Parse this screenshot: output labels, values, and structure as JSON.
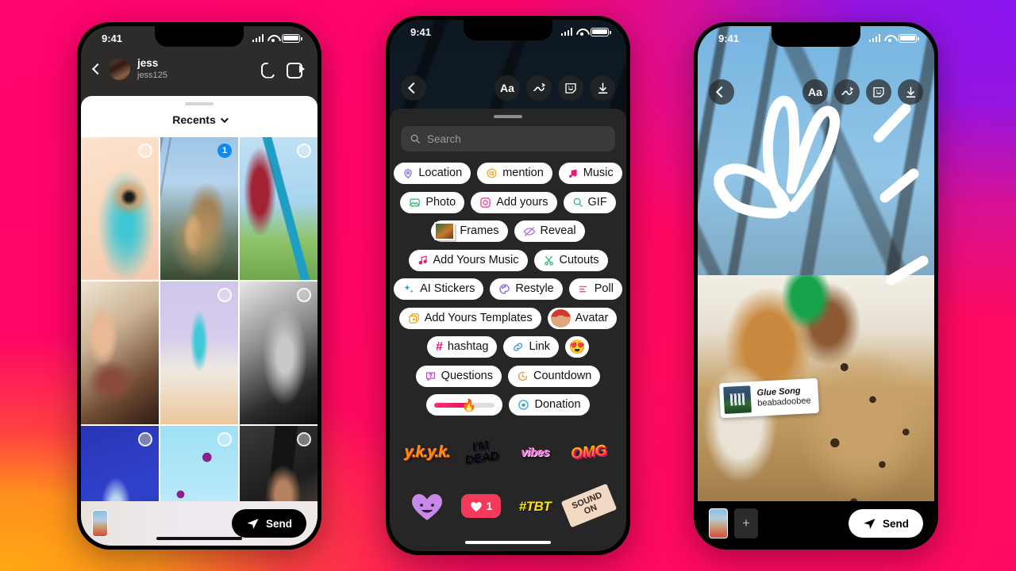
{
  "background": {
    "gradient_colors": [
      "#FF0470",
      "#8A16F0",
      "#FFA812",
      "#FF0A60"
    ]
  },
  "phones": {
    "phone1": {
      "name": "dm-gallery-picker",
      "status_bar": {
        "time": "9:41",
        "icons": [
          "signal-icon",
          "wifi-icon",
          "battery-icon"
        ]
      },
      "dm_header": {
        "back_icon": "back-chevron-icon",
        "display_name": "jess",
        "username": "jess125",
        "call_icon": "phone-call-icon",
        "video_icon": "video-call-icon"
      },
      "sheet": {
        "album_label": "Recents",
        "album_chevron": "chevron-down-icon",
        "grid": [
          {
            "id": "tile-1",
            "style": "ph-a",
            "selection": "empty"
          },
          {
            "id": "tile-2",
            "style": "ph-b",
            "selection": "1"
          },
          {
            "id": "tile-3",
            "style": "ph-c",
            "selection": "empty"
          },
          {
            "id": "tile-4",
            "style": "ph-d",
            "selection": "none"
          },
          {
            "id": "tile-5",
            "style": "ph-e",
            "selection": "empty"
          },
          {
            "id": "tile-6",
            "style": "ph-f",
            "selection": "empty"
          },
          {
            "id": "tile-7",
            "style": "ph-g",
            "selection": "grey"
          },
          {
            "id": "tile-8",
            "style": "ph-h",
            "selection": "empty"
          },
          {
            "id": "tile-9",
            "style": "ph-i",
            "selection": "grey"
          }
        ]
      },
      "bottom_bar": {
        "send_label": "Send",
        "send_icon": "paper-plane-icon",
        "thumb": "selected-photo-thumbnail"
      }
    },
    "phone2": {
      "name": "sticker-tray",
      "status_bar": {
        "time": "9:41",
        "icons": [
          "signal-icon",
          "wifi-icon",
          "battery-icon"
        ]
      },
      "top_bar": {
        "back_icon": "back-chevron-icon",
        "tools": [
          "text-tool-icon",
          "draw-tool-icon",
          "sticker-tool-icon",
          "download-icon"
        ],
        "text_tool_label": "Aa"
      },
      "search": {
        "placeholder": "Search",
        "icon": "search-icon"
      },
      "chip_rows": [
        [
          {
            "label": "Location",
            "icon": "location-pin-icon",
            "color": "#7b5cf0"
          },
          {
            "label": "mention",
            "icon": "threads-at-icon",
            "color": "#f5a524"
          },
          {
            "label": "Music",
            "icon": "music-note-icon",
            "color": "#e8197d"
          }
        ],
        [
          {
            "label": "Photo",
            "icon": "photo-icon",
            "color": "#2bb673"
          },
          {
            "label": "Add yours",
            "icon": "camera-icon",
            "color": "#ef2e8a"
          },
          {
            "label": "GIF",
            "icon": "gif-search-icon",
            "color": "#2bb673"
          }
        ],
        [
          {
            "label": "Frames",
            "icon": "polaroid-frames-icon",
            "color": "#c86a3a"
          },
          {
            "label": "Reveal",
            "icon": "reveal-eye-icon",
            "color": "#b06ae8"
          }
        ],
        [
          {
            "label": "Add Yours Music",
            "icon": "music-note-icon",
            "color": "#e8197d"
          },
          {
            "label": "Cutouts",
            "icon": "scissors-icon",
            "color": "#2bb673"
          }
        ],
        [
          {
            "label": "AI Stickers",
            "icon": "ai-sparkle-icon",
            "color": "#2b9fe8"
          },
          {
            "label": "Restyle",
            "icon": "restyle-palette-icon",
            "color": "#8b5cf6"
          },
          {
            "label": "Poll",
            "icon": "poll-bars-icon",
            "color": "#ef4a9a"
          }
        ],
        [
          {
            "label": "Add Yours Templates",
            "icon": "templates-icon",
            "color": "#e0a020"
          },
          {
            "label": "Avatar",
            "icon": "avatar-face-icon",
            "color": "#d03a2a"
          }
        ],
        [
          {
            "label": "hashtag",
            "icon": "hashtag-icon",
            "color": "#e8197d"
          },
          {
            "label": "Link",
            "icon": "link-chain-icon",
            "color": "#2b9fe8"
          },
          {
            "label": "",
            "icon": "heart-eyes-emoji",
            "emoji": "😍"
          }
        ],
        [
          {
            "label": "Questions",
            "icon": "question-bubble-icon",
            "color": "#d33ae0"
          },
          {
            "label": "Countdown",
            "icon": "countdown-clock-icon",
            "color": "#e8903a"
          }
        ],
        [
          {
            "label": "",
            "icon": "emoji-slider-icon",
            "emoji": "🔥"
          },
          {
            "label": "Donation",
            "icon": "donation-heart-icon",
            "color": "#2b9fe8"
          }
        ]
      ],
      "stickers": [
        {
          "name": "ykyk-sticker",
          "text": "y.k.y.k."
        },
        {
          "name": "im-dead-sticker",
          "text": "I'M DEAD"
        },
        {
          "name": "vibes-sticker",
          "text": "vibes"
        },
        {
          "name": "omg-sticker",
          "text": "OMG"
        },
        {
          "name": "purple-heart-face-sticker",
          "text": ""
        },
        {
          "name": "like-count-sticker",
          "text": "1"
        },
        {
          "name": "tbt-sticker",
          "text": "#TBT"
        },
        {
          "name": "sound-on-sticker",
          "text": "SOUND ON"
        }
      ]
    },
    "phone3": {
      "name": "story-composer",
      "status_bar": {
        "time": "9:41",
        "icons": [
          "signal-icon",
          "wifi-icon",
          "battery-icon"
        ]
      },
      "top_bar": {
        "back_icon": "back-chevron-icon",
        "tools": [
          "text-tool-icon",
          "draw-tool-icon",
          "sticker-tool-icon",
          "download-icon"
        ],
        "text_tool_label": "Aa"
      },
      "music_sticker": {
        "title": "Glue Song",
        "artist": "beabadoobee",
        "art": "album-art"
      },
      "bottom_bar": {
        "send_label": "Send",
        "send_icon": "paper-plane-icon",
        "add_label": "+"
      }
    }
  }
}
